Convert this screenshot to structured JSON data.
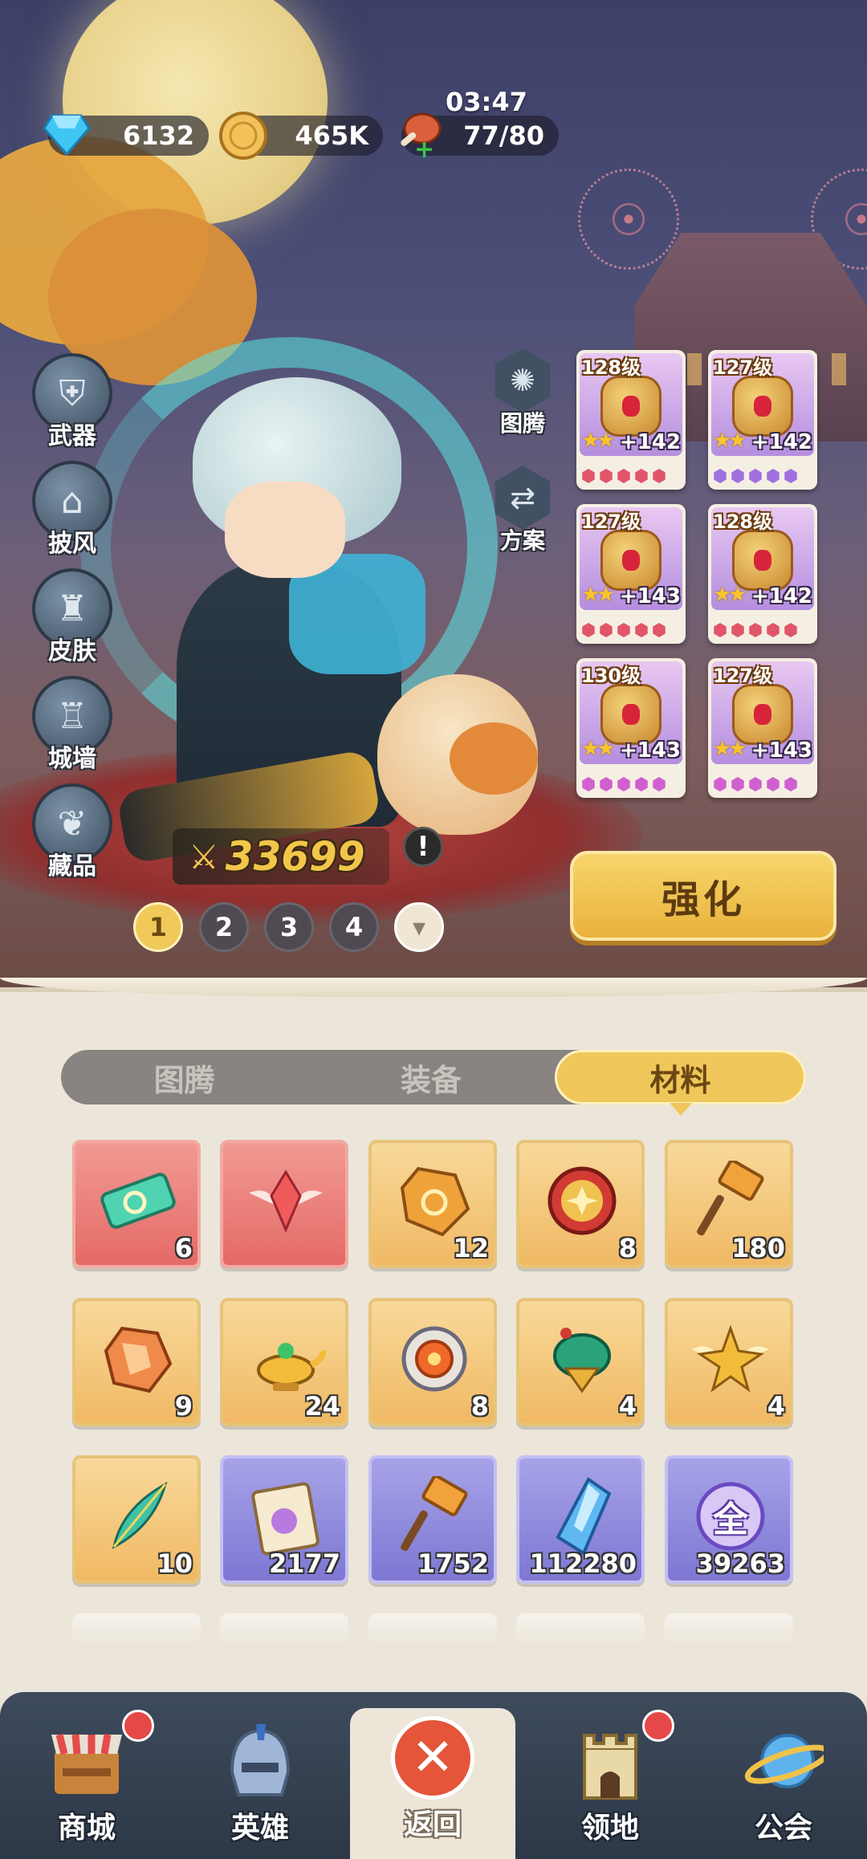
{
  "resources": {
    "gems": "6132",
    "gold": "465K",
    "stamina": "77/80",
    "timer": "03:47"
  },
  "side_menu": [
    {
      "label": "武器",
      "icon": "armor-icon"
    },
    {
      "label": "披风",
      "icon": "cloak-icon"
    },
    {
      "label": "皮肤",
      "icon": "skin-icon"
    },
    {
      "label": "城墙",
      "icon": "wall-icon"
    },
    {
      "label": "藏品",
      "icon": "collection-icon"
    }
  ],
  "hex_menu": [
    {
      "label": "图腾",
      "icon": "totem-icon"
    },
    {
      "label": "方案",
      "icon": "preset-icon"
    }
  ],
  "power": "33699",
  "pager": [
    "1",
    "2",
    "3",
    "4"
  ],
  "equipment": [
    {
      "level": "128级",
      "plus": "+142",
      "gem_color": "#e0556a",
      "star_count": 2
    },
    {
      "level": "127级",
      "plus": "+142",
      "gem_color": "#a070e0",
      "star_count": 2
    },
    {
      "level": "127级",
      "plus": "+143",
      "gem_color": "#e0556a",
      "star_count": 2
    },
    {
      "level": "128级",
      "plus": "+142",
      "gem_color": "#e0556a",
      "star_count": 2
    },
    {
      "level": "130级",
      "plus": "+143",
      "gem_color": "#d060d0",
      "star_count": 2
    },
    {
      "level": "127级",
      "plus": "+143",
      "gem_color": "#d060d0",
      "star_count": 2
    }
  ],
  "upgrade_label": "强化",
  "tabs": [
    "图腾",
    "装备",
    "材料"
  ],
  "active_tab": 2,
  "materials": [
    {
      "count": "6",
      "rarity": "red",
      "icon": "ticket-icon"
    },
    {
      "count": "",
      "rarity": "red",
      "icon": "winged-gem-icon"
    },
    {
      "count": "12",
      "rarity": "orange",
      "icon": "ore-icon"
    },
    {
      "count": "8",
      "rarity": "orange",
      "icon": "coin-icon"
    },
    {
      "count": "180",
      "rarity": "orange",
      "icon": "hammer-icon"
    },
    {
      "count": "9",
      "rarity": "orange",
      "icon": "crystal-icon"
    },
    {
      "count": "24",
      "rarity": "orange",
      "icon": "lamp-icon"
    },
    {
      "count": "8",
      "rarity": "orange",
      "icon": "shield-orb-icon"
    },
    {
      "count": "4",
      "rarity": "orange",
      "icon": "spinning-top-icon"
    },
    {
      "count": "4",
      "rarity": "orange",
      "icon": "winged-star-icon"
    },
    {
      "count": "10",
      "rarity": "orange",
      "icon": "feather-icon"
    },
    {
      "count": "2177",
      "rarity": "purple",
      "icon": "scroll-icon"
    },
    {
      "count": "1752",
      "rarity": "purple",
      "icon": "hammer-icon"
    },
    {
      "count": "112280",
      "rarity": "purple",
      "icon": "shard-icon"
    },
    {
      "count": "39263",
      "rarity": "purple",
      "icon": "all-orb-icon"
    }
  ],
  "all_orb_char": "全",
  "nav": [
    {
      "label": "商城",
      "icon": "shop-icon",
      "badge": true
    },
    {
      "label": "英雄",
      "icon": "helmet-icon",
      "badge": false
    },
    {
      "label": "返回",
      "icon": "close-icon",
      "badge": false
    },
    {
      "label": "领地",
      "icon": "castle-icon",
      "badge": true
    },
    {
      "label": "公会",
      "icon": "planet-icon",
      "badge": false
    }
  ]
}
